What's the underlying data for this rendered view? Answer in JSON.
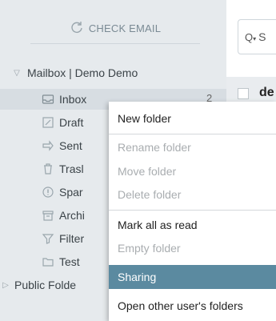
{
  "sidebar": {
    "check_email": "CHECK EMAIL",
    "mailbox": "Mailbox | Demo Demo",
    "public": "Public Folde",
    "folders": [
      {
        "label": "Inbox",
        "icon": "inbox-icon",
        "count": "2"
      },
      {
        "label": "Draft",
        "icon": "drafts-icon"
      },
      {
        "label": "Sent",
        "icon": "sent-icon"
      },
      {
        "label": "Trasl",
        "icon": "trash-icon"
      },
      {
        "label": "Spar",
        "icon": "spam-icon"
      },
      {
        "label": "Archi",
        "icon": "archive-icon"
      },
      {
        "label": "Filter",
        "icon": "filter-icon"
      },
      {
        "label": "Test",
        "icon": "folder-icon"
      }
    ]
  },
  "main": {
    "search_placeholder": "S",
    "row_sender": "de"
  },
  "context_menu": {
    "items": [
      {
        "label": "New folder",
        "enabled": true
      },
      {
        "label": "Rename folder",
        "enabled": false
      },
      {
        "label": "Move folder",
        "enabled": false
      },
      {
        "label": "Delete folder",
        "enabled": false
      },
      {
        "label": "Mark all as read",
        "enabled": true
      },
      {
        "label": "Empty folder",
        "enabled": false
      },
      {
        "label": "Sharing",
        "enabled": true,
        "highlighted": true
      },
      {
        "label": "Open other user's folders",
        "enabled": true
      }
    ]
  },
  "colors": {
    "sidebar_bg": "#e6eaed",
    "menu_highlight": "#5b8aa0",
    "disabled_text": "#a9adb0"
  }
}
